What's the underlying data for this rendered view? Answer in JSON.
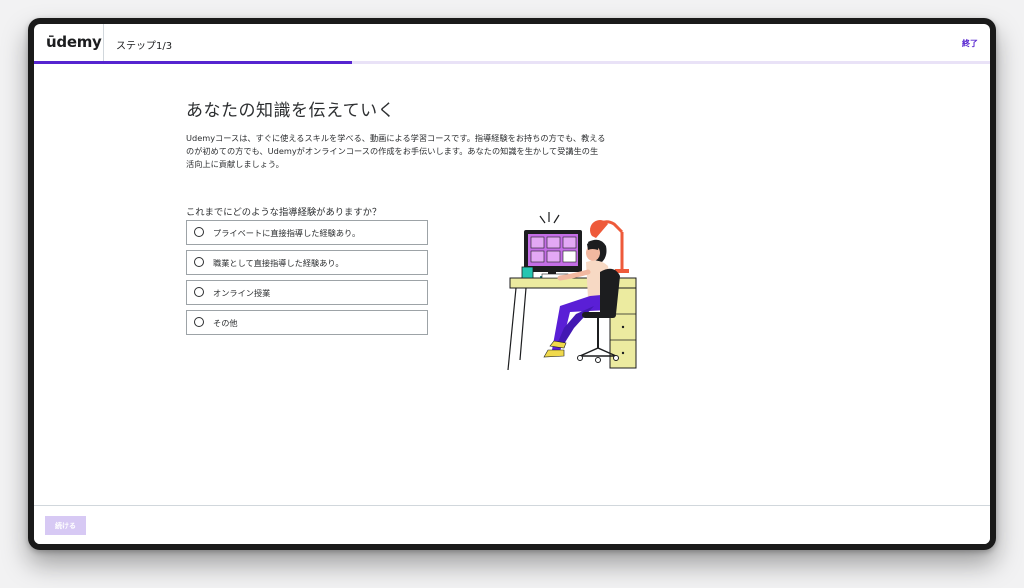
{
  "header": {
    "logo": "ūdemy",
    "step": "ステップ1/3",
    "exit_label": "終了",
    "progress": 0.333
  },
  "main": {
    "title": "あなたの知識を伝えていく",
    "description": "Udemyコースは、すぐに使えるスキルを学べる、動画による学習コースです。指導経験をお持ちの方でも、教えるのが初めての方でも、Udemyがオンラインコースの作成をお手伝いします。あなたの知識を生かして受講生の生活向上に貢献しましょう。",
    "question": "これまでにどのような指導経験がありますか？",
    "options": [
      {
        "label": "プライベートに直接指導した経験あり。"
      },
      {
        "label": "職業として直接指導した経験あり。"
      },
      {
        "label": "オンライン授業"
      },
      {
        "label": "その他"
      }
    ]
  },
  "footer": {
    "continue_label": "続ける"
  },
  "colors": {
    "brand": "#5624d0",
    "button_disabled": "#d7c9f4"
  }
}
